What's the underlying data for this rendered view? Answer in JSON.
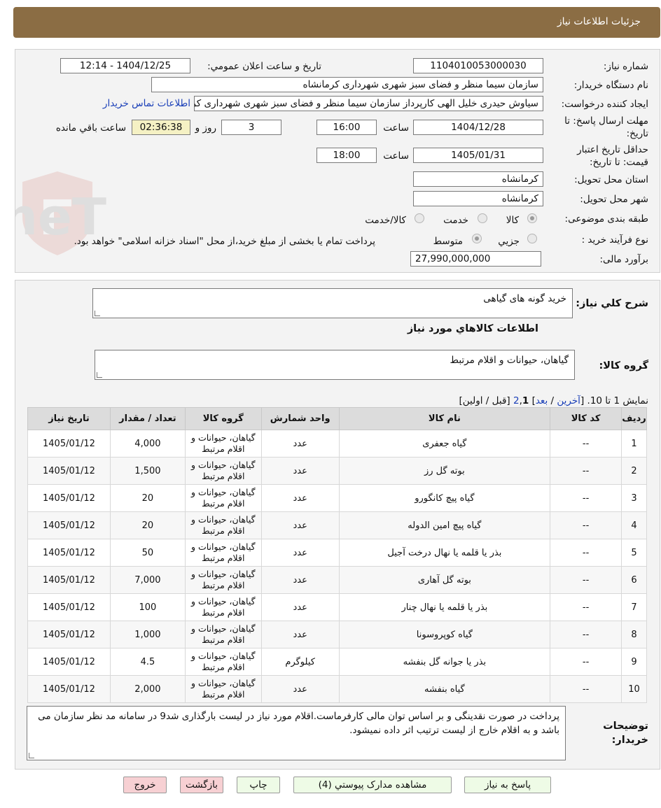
{
  "header": {
    "title": "جزئیات اطلاعات نیاز"
  },
  "form": {
    "need_number_label": "شماره نیاز:",
    "need_number": "1104010053000030",
    "announce_label": "تاریخ و ساعت اعلان عمومي:",
    "announce_value": "1404/12/25 - 12:14",
    "buyer_org_label": "نام دستگاه خریدار:",
    "buyer_org": "سازمان سیما منظر و فضای سبز شهری شهرداری کرمانشاه",
    "requester_label": "ایجاد کننده درخواست:",
    "requester": "سیاوش حیدری خلیل الهی کارپرداز سازمان سیما منظر و فضای سبز شهری شهرداری کرمانشاه",
    "contact_link": "اطلاعات تماس خریدار",
    "deadline_label_1": "مهلت ارسال پاسخ: تا",
    "deadline_label_2": "تاریخ:",
    "deadline_date": "1404/12/28",
    "time_label": "ساعت",
    "deadline_time": "16:00",
    "days_value": "3",
    "days_label": "روز و",
    "remaining_time": "02:36:38",
    "remaining_label": "ساعت باقي مانده",
    "validity_label_1": "حداقل تاریخ اعتبار",
    "validity_label_2": "قیمت: تا تاریخ:",
    "validity_date": "1405/01/31",
    "validity_time": "18:00",
    "province_label": "استان محل تحویل:",
    "province": "کرمانشاه",
    "city_label": "شهر محل تحویل:",
    "city": "کرمانشاه",
    "category_label": "طبقه بندی موضوعی:",
    "category_options": [
      "کالا",
      "خدمت",
      "کالا/خدمت"
    ],
    "process_label": "نوع فرآیند خرید :",
    "process_options": [
      "جزيي",
      "متوسط"
    ],
    "process_note": "پرداخت تمام یا بخشی از مبلغ خرید،از محل \"اسناد خزانه اسلامی\" خواهد بود.",
    "estimate_label": "برآورد مالی:",
    "estimate_value": "27,990,000,000"
  },
  "watermark": {
    "text": "AriaTender.neT"
  },
  "details": {
    "summary_label": "شرح كلي نياز:",
    "summary_value": "خرید گونه های گیاهی",
    "goods_info_title": "اطلاعات كالاهاي مورد نياز",
    "goods_group_label": "گروه كالا:",
    "goods_group_value": "گیاهان، حیوانات و اقلام مرتبط",
    "pagination": {
      "show_text": "نمایش 1 تا 10.",
      "open_bracket": "[",
      "last": "آخرین",
      "slash1": "/",
      "next": "بعد",
      "close_bracket": "]",
      "page2": "2",
      "comma": ",",
      "page1": "1",
      "prev_first": "[قبل / اولین]"
    },
    "columns": [
      "رديف",
      "کد کالا",
      "نام کالا",
      "واحد شمارش",
      "گروه کالا",
      "تعداد / مقدار",
      "تاریخ نیاز"
    ],
    "rows": [
      {
        "idx": "1",
        "code": "--",
        "name": "گیاه جعفری",
        "unit": "عدد",
        "group": "گیاهان، حیوانات و اقلام مرتبط",
        "qty": "4,000",
        "date": "1405/01/12"
      },
      {
        "idx": "2",
        "code": "--",
        "name": "بوته گل رز",
        "unit": "عدد",
        "group": "گیاهان، حیوانات و اقلام مرتبط",
        "qty": "1,500",
        "date": "1405/01/12"
      },
      {
        "idx": "3",
        "code": "--",
        "name": "گیاه پیچ کانگورو",
        "unit": "عدد",
        "group": "گیاهان، حیوانات و اقلام مرتبط",
        "qty": "20",
        "date": "1405/01/12"
      },
      {
        "idx": "4",
        "code": "--",
        "name": "گیاه پیچ امین الدوله",
        "unit": "عدد",
        "group": "گیاهان، حیوانات و اقلام مرتبط",
        "qty": "20",
        "date": "1405/01/12"
      },
      {
        "idx": "5",
        "code": "--",
        "name": "بذر یا قلمه یا نهال درخت آجیل",
        "unit": "عدد",
        "group": "گیاهان، حیوانات و اقلام مرتبط",
        "qty": "50",
        "date": "1405/01/12"
      },
      {
        "idx": "6",
        "code": "--",
        "name": "بوته گل آهاری",
        "unit": "عدد",
        "group": "گیاهان، حیوانات و اقلام مرتبط",
        "qty": "7,000",
        "date": "1405/01/12"
      },
      {
        "idx": "7",
        "code": "--",
        "name": "بذر یا قلمه یا نهال چنار",
        "unit": "عدد",
        "group": "گیاهان، حیوانات و اقلام مرتبط",
        "qty": "100",
        "date": "1405/01/12"
      },
      {
        "idx": "8",
        "code": "--",
        "name": "گیاه کوپروسونا",
        "unit": "عدد",
        "group": "گیاهان، حیوانات و اقلام مرتبط",
        "qty": "1,000",
        "date": "1405/01/12"
      },
      {
        "idx": "9",
        "code": "--",
        "name": "بذر یا جوانه گل بنفشه",
        "unit": "کیلوگرم",
        "group": "گیاهان، حیوانات و اقلام مرتبط",
        "qty": "4.5",
        "date": "1405/01/12"
      },
      {
        "idx": "10",
        "code": "--",
        "name": "گیاه بنفشه",
        "unit": "عدد",
        "group": "گیاهان، حیوانات و اقلام مرتبط",
        "qty": "2,000",
        "date": "1405/01/12"
      }
    ],
    "buyer_notes_label": "توضیحات خریدار:",
    "buyer_notes": "پرداخت در صورت نقدینگی و بر اساس توان مالی کارفرماست.اقلام مورد نیاز در لیست بارگذاری شد9 در سامانه مد نظر سازمان می باشد و به اقلام خارج از لیست ترتیب اثر داده نمیشود."
  },
  "buttons": {
    "reply": "پاسخ به نیاز",
    "attachments": "مشاهده مدارک پیوستي (4)",
    "print": "چاپ",
    "back": "بازگشت",
    "exit": "خروج"
  },
  "colors": {
    "header_bg": "#8b6d44",
    "link": "#1a3fb8",
    "remaining_bg": "#f5f1c4",
    "button_green": "#eefbe6",
    "button_red": "#f7d0d3"
  }
}
